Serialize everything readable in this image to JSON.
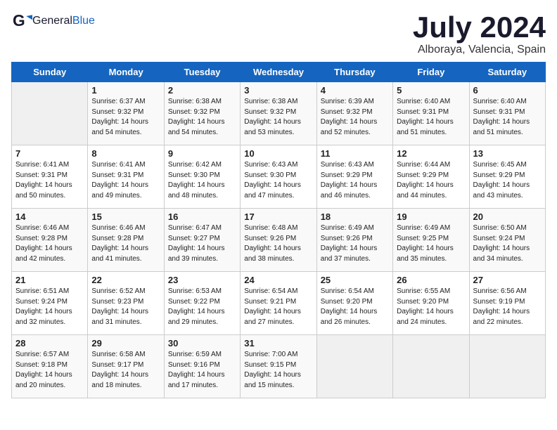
{
  "header": {
    "logo_general": "General",
    "logo_blue": "Blue",
    "month": "July 2024",
    "location": "Alboraya, Valencia, Spain"
  },
  "days_of_week": [
    "Sunday",
    "Monday",
    "Tuesday",
    "Wednesday",
    "Thursday",
    "Friday",
    "Saturday"
  ],
  "weeks": [
    [
      {
        "day": "",
        "sunrise": "",
        "sunset": "",
        "daylight": "",
        "empty": true
      },
      {
        "day": "1",
        "sunrise": "Sunrise: 6:37 AM",
        "sunset": "Sunset: 9:32 PM",
        "daylight": "Daylight: 14 hours and 54 minutes."
      },
      {
        "day": "2",
        "sunrise": "Sunrise: 6:38 AM",
        "sunset": "Sunset: 9:32 PM",
        "daylight": "Daylight: 14 hours and 54 minutes."
      },
      {
        "day": "3",
        "sunrise": "Sunrise: 6:38 AM",
        "sunset": "Sunset: 9:32 PM",
        "daylight": "Daylight: 14 hours and 53 minutes."
      },
      {
        "day": "4",
        "sunrise": "Sunrise: 6:39 AM",
        "sunset": "Sunset: 9:32 PM",
        "daylight": "Daylight: 14 hours and 52 minutes."
      },
      {
        "day": "5",
        "sunrise": "Sunrise: 6:40 AM",
        "sunset": "Sunset: 9:31 PM",
        "daylight": "Daylight: 14 hours and 51 minutes."
      },
      {
        "day": "6",
        "sunrise": "Sunrise: 6:40 AM",
        "sunset": "Sunset: 9:31 PM",
        "daylight": "Daylight: 14 hours and 51 minutes."
      }
    ],
    [
      {
        "day": "7",
        "sunrise": "Sunrise: 6:41 AM",
        "sunset": "Sunset: 9:31 PM",
        "daylight": "Daylight: 14 hours and 50 minutes."
      },
      {
        "day": "8",
        "sunrise": "Sunrise: 6:41 AM",
        "sunset": "Sunset: 9:31 PM",
        "daylight": "Daylight: 14 hours and 49 minutes."
      },
      {
        "day": "9",
        "sunrise": "Sunrise: 6:42 AM",
        "sunset": "Sunset: 9:30 PM",
        "daylight": "Daylight: 14 hours and 48 minutes."
      },
      {
        "day": "10",
        "sunrise": "Sunrise: 6:43 AM",
        "sunset": "Sunset: 9:30 PM",
        "daylight": "Daylight: 14 hours and 47 minutes."
      },
      {
        "day": "11",
        "sunrise": "Sunrise: 6:43 AM",
        "sunset": "Sunset: 9:29 PM",
        "daylight": "Daylight: 14 hours and 46 minutes."
      },
      {
        "day": "12",
        "sunrise": "Sunrise: 6:44 AM",
        "sunset": "Sunset: 9:29 PM",
        "daylight": "Daylight: 14 hours and 44 minutes."
      },
      {
        "day": "13",
        "sunrise": "Sunrise: 6:45 AM",
        "sunset": "Sunset: 9:29 PM",
        "daylight": "Daylight: 14 hours and 43 minutes."
      }
    ],
    [
      {
        "day": "14",
        "sunrise": "Sunrise: 6:46 AM",
        "sunset": "Sunset: 9:28 PM",
        "daylight": "Daylight: 14 hours and 42 minutes."
      },
      {
        "day": "15",
        "sunrise": "Sunrise: 6:46 AM",
        "sunset": "Sunset: 9:28 PM",
        "daylight": "Daylight: 14 hours and 41 minutes."
      },
      {
        "day": "16",
        "sunrise": "Sunrise: 6:47 AM",
        "sunset": "Sunset: 9:27 PM",
        "daylight": "Daylight: 14 hours and 39 minutes."
      },
      {
        "day": "17",
        "sunrise": "Sunrise: 6:48 AM",
        "sunset": "Sunset: 9:26 PM",
        "daylight": "Daylight: 14 hours and 38 minutes."
      },
      {
        "day": "18",
        "sunrise": "Sunrise: 6:49 AM",
        "sunset": "Sunset: 9:26 PM",
        "daylight": "Daylight: 14 hours and 37 minutes."
      },
      {
        "day": "19",
        "sunrise": "Sunrise: 6:49 AM",
        "sunset": "Sunset: 9:25 PM",
        "daylight": "Daylight: 14 hours and 35 minutes."
      },
      {
        "day": "20",
        "sunrise": "Sunrise: 6:50 AM",
        "sunset": "Sunset: 9:24 PM",
        "daylight": "Daylight: 14 hours and 34 minutes."
      }
    ],
    [
      {
        "day": "21",
        "sunrise": "Sunrise: 6:51 AM",
        "sunset": "Sunset: 9:24 PM",
        "daylight": "Daylight: 14 hours and 32 minutes."
      },
      {
        "day": "22",
        "sunrise": "Sunrise: 6:52 AM",
        "sunset": "Sunset: 9:23 PM",
        "daylight": "Daylight: 14 hours and 31 minutes."
      },
      {
        "day": "23",
        "sunrise": "Sunrise: 6:53 AM",
        "sunset": "Sunset: 9:22 PM",
        "daylight": "Daylight: 14 hours and 29 minutes."
      },
      {
        "day": "24",
        "sunrise": "Sunrise: 6:54 AM",
        "sunset": "Sunset: 9:21 PM",
        "daylight": "Daylight: 14 hours and 27 minutes."
      },
      {
        "day": "25",
        "sunrise": "Sunrise: 6:54 AM",
        "sunset": "Sunset: 9:20 PM",
        "daylight": "Daylight: 14 hours and 26 minutes."
      },
      {
        "day": "26",
        "sunrise": "Sunrise: 6:55 AM",
        "sunset": "Sunset: 9:20 PM",
        "daylight": "Daylight: 14 hours and 24 minutes."
      },
      {
        "day": "27",
        "sunrise": "Sunrise: 6:56 AM",
        "sunset": "Sunset: 9:19 PM",
        "daylight": "Daylight: 14 hours and 22 minutes."
      }
    ],
    [
      {
        "day": "28",
        "sunrise": "Sunrise: 6:57 AM",
        "sunset": "Sunset: 9:18 PM",
        "daylight": "Daylight: 14 hours and 20 minutes."
      },
      {
        "day": "29",
        "sunrise": "Sunrise: 6:58 AM",
        "sunset": "Sunset: 9:17 PM",
        "daylight": "Daylight: 14 hours and 18 minutes."
      },
      {
        "day": "30",
        "sunrise": "Sunrise: 6:59 AM",
        "sunset": "Sunset: 9:16 PM",
        "daylight": "Daylight: 14 hours and 17 minutes."
      },
      {
        "day": "31",
        "sunrise": "Sunrise: 7:00 AM",
        "sunset": "Sunset: 9:15 PM",
        "daylight": "Daylight: 14 hours and 15 minutes."
      },
      {
        "day": "",
        "sunrise": "",
        "sunset": "",
        "daylight": "",
        "empty": true
      },
      {
        "day": "",
        "sunrise": "",
        "sunset": "",
        "daylight": "",
        "empty": true
      },
      {
        "day": "",
        "sunrise": "",
        "sunset": "",
        "daylight": "",
        "empty": true
      }
    ]
  ]
}
